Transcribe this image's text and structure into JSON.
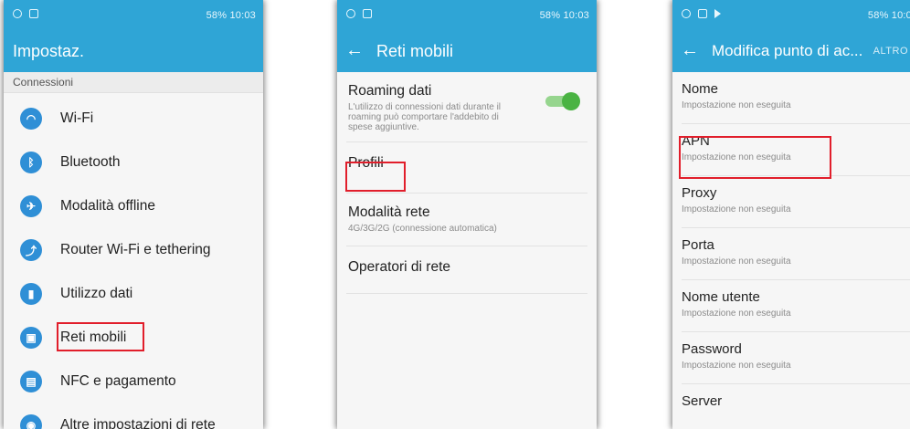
{
  "status_bar": {
    "right_text": "58% 10:03"
  },
  "status_bar_p3": {
    "right_text": "58% 10:0"
  },
  "panel1": {
    "title": "Impostaz.",
    "section": "Connessioni",
    "items": [
      {
        "label": "Wi-Fi",
        "icon": "wifi-icon",
        "glyph": "◠"
      },
      {
        "label": "Bluetooth",
        "icon": "bluetooth-icon",
        "glyph": "ᛒ"
      },
      {
        "label": "Modalità offline",
        "icon": "airplane-icon",
        "glyph": "✈"
      },
      {
        "label": "Router Wi-Fi e tethering",
        "icon": "hotspot-icon",
        "glyph": "⤴"
      },
      {
        "label": "Utilizzo dati",
        "icon": "data-usage-icon",
        "glyph": "▮"
      },
      {
        "label": "Reti mobili",
        "icon": "mobile-networks-icon",
        "glyph": "▣"
      },
      {
        "label": "NFC e pagamento",
        "icon": "nfc-icon",
        "glyph": "▤"
      },
      {
        "label": "Altre impostazioni di rete",
        "icon": "more-networks-icon",
        "glyph": "◉"
      }
    ]
  },
  "panel2": {
    "title": "Reti mobili",
    "back_icon": "←",
    "items": [
      {
        "title": "Roaming dati",
        "subtitle": "L'utilizzo di connessioni dati durante il roaming può comportare l'addebito di spese aggiuntive."
      },
      {
        "title": "Profili",
        "subtitle": ""
      },
      {
        "title": "Modalità rete",
        "subtitle": "4G/3G/2G (connessione automatica)"
      },
      {
        "title": "Operatori di rete",
        "subtitle": ""
      }
    ],
    "roaming_toggle": {
      "state": "on",
      "color": "#4ab343"
    }
  },
  "panel3": {
    "title": "Modifica punto di ac...",
    "back_icon": "←",
    "more_label": "ALTRO",
    "items": [
      {
        "title": "Nome",
        "subtitle": "Impostazione non eseguita"
      },
      {
        "title": "APN",
        "subtitle": "Impostazione non eseguita"
      },
      {
        "title": "Proxy",
        "subtitle": "Impostazione non eseguita"
      },
      {
        "title": "Porta",
        "subtitle": "Impostazione non eseguita"
      },
      {
        "title": "Nome utente",
        "subtitle": "Impostazione non eseguita"
      },
      {
        "title": "Password",
        "subtitle": "Impostazione non eseguita"
      },
      {
        "title": "Server",
        "subtitle": ""
      }
    ]
  },
  "colors": {
    "app_bar": "#2fa5d6",
    "icon": "#2f8fd6",
    "highlight": "#e11e2b"
  }
}
